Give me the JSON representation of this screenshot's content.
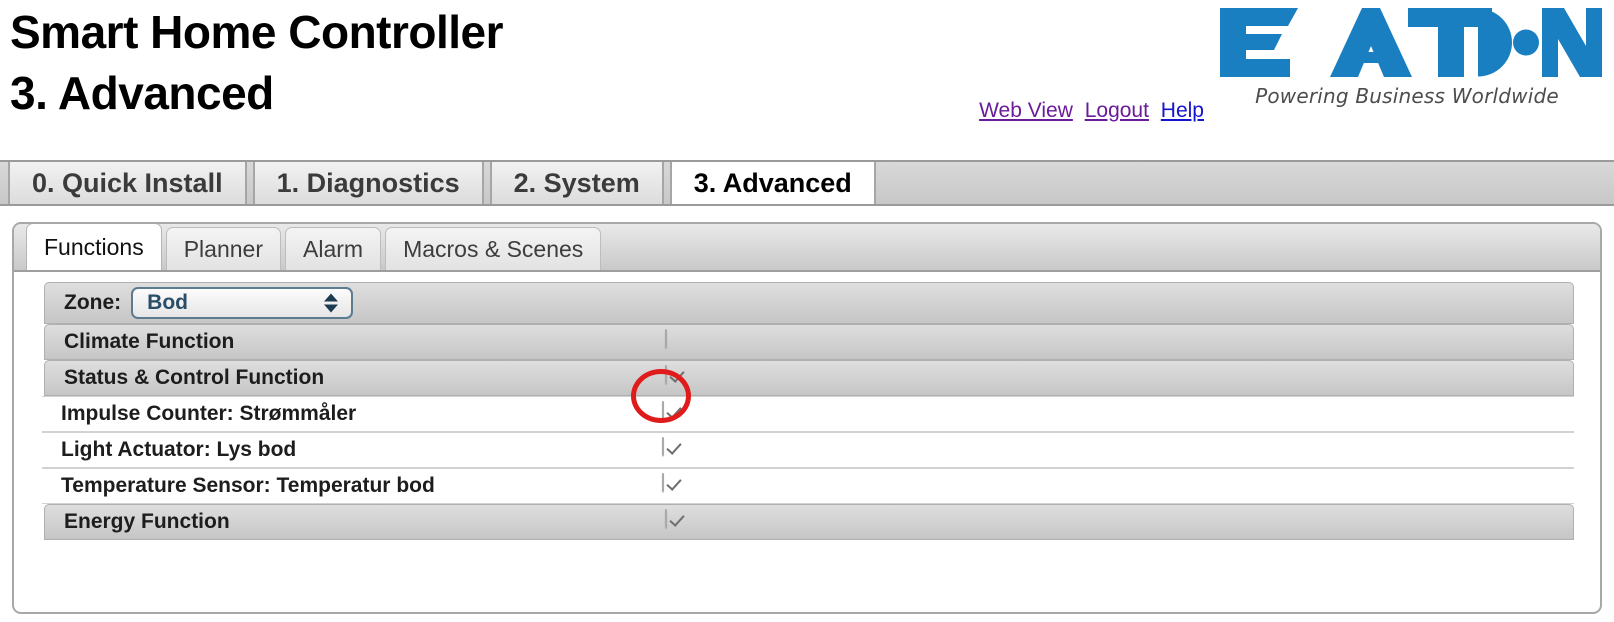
{
  "header": {
    "title": "Smart Home Controller\n3. Advanced",
    "links": [
      {
        "label": "Web View",
        "state": "visited"
      },
      {
        "label": "Logout",
        "state": "visited"
      },
      {
        "label": "Help",
        "state": "unvisited"
      }
    ],
    "logo": {
      "wordmark": "EAT·N",
      "tagline": "Powering Business Worldwide",
      "color": "#1a7fc1"
    }
  },
  "main_tabs": [
    {
      "label": "0. Quick Install",
      "active": false
    },
    {
      "label": "1. Diagnostics",
      "active": false
    },
    {
      "label": "2. System",
      "active": false
    },
    {
      "label": "3. Advanced",
      "active": true
    }
  ],
  "sub_tabs": [
    {
      "label": "Functions",
      "active": true
    },
    {
      "label": "Planner",
      "active": false
    },
    {
      "label": "Alarm",
      "active": false
    },
    {
      "label": "Macros & Scenes",
      "active": false
    }
  ],
  "zone": {
    "label": "Zone:",
    "value": "Bod"
  },
  "function_rows": [
    {
      "label": "Climate Function",
      "checked": false,
      "style": "shaded",
      "annotated": true
    },
    {
      "label": "Status & Control Function",
      "checked": true,
      "style": "shaded",
      "annotated": false
    },
    {
      "label": "Impulse Counter: Strømmåler",
      "checked": true,
      "style": "plain",
      "annotated": false
    },
    {
      "label": "Light Actuator: Lys bod",
      "checked": true,
      "style": "plain",
      "annotated": false
    },
    {
      "label": "Temperature Sensor: Temperatur bod",
      "checked": true,
      "style": "plain",
      "annotated": false
    },
    {
      "label": "Energy Function",
      "checked": true,
      "style": "shaded",
      "annotated": false
    }
  ],
  "annotation": {
    "shape": "ellipse",
    "color": "#e01b1b",
    "target": "climate-function-checkbox"
  }
}
